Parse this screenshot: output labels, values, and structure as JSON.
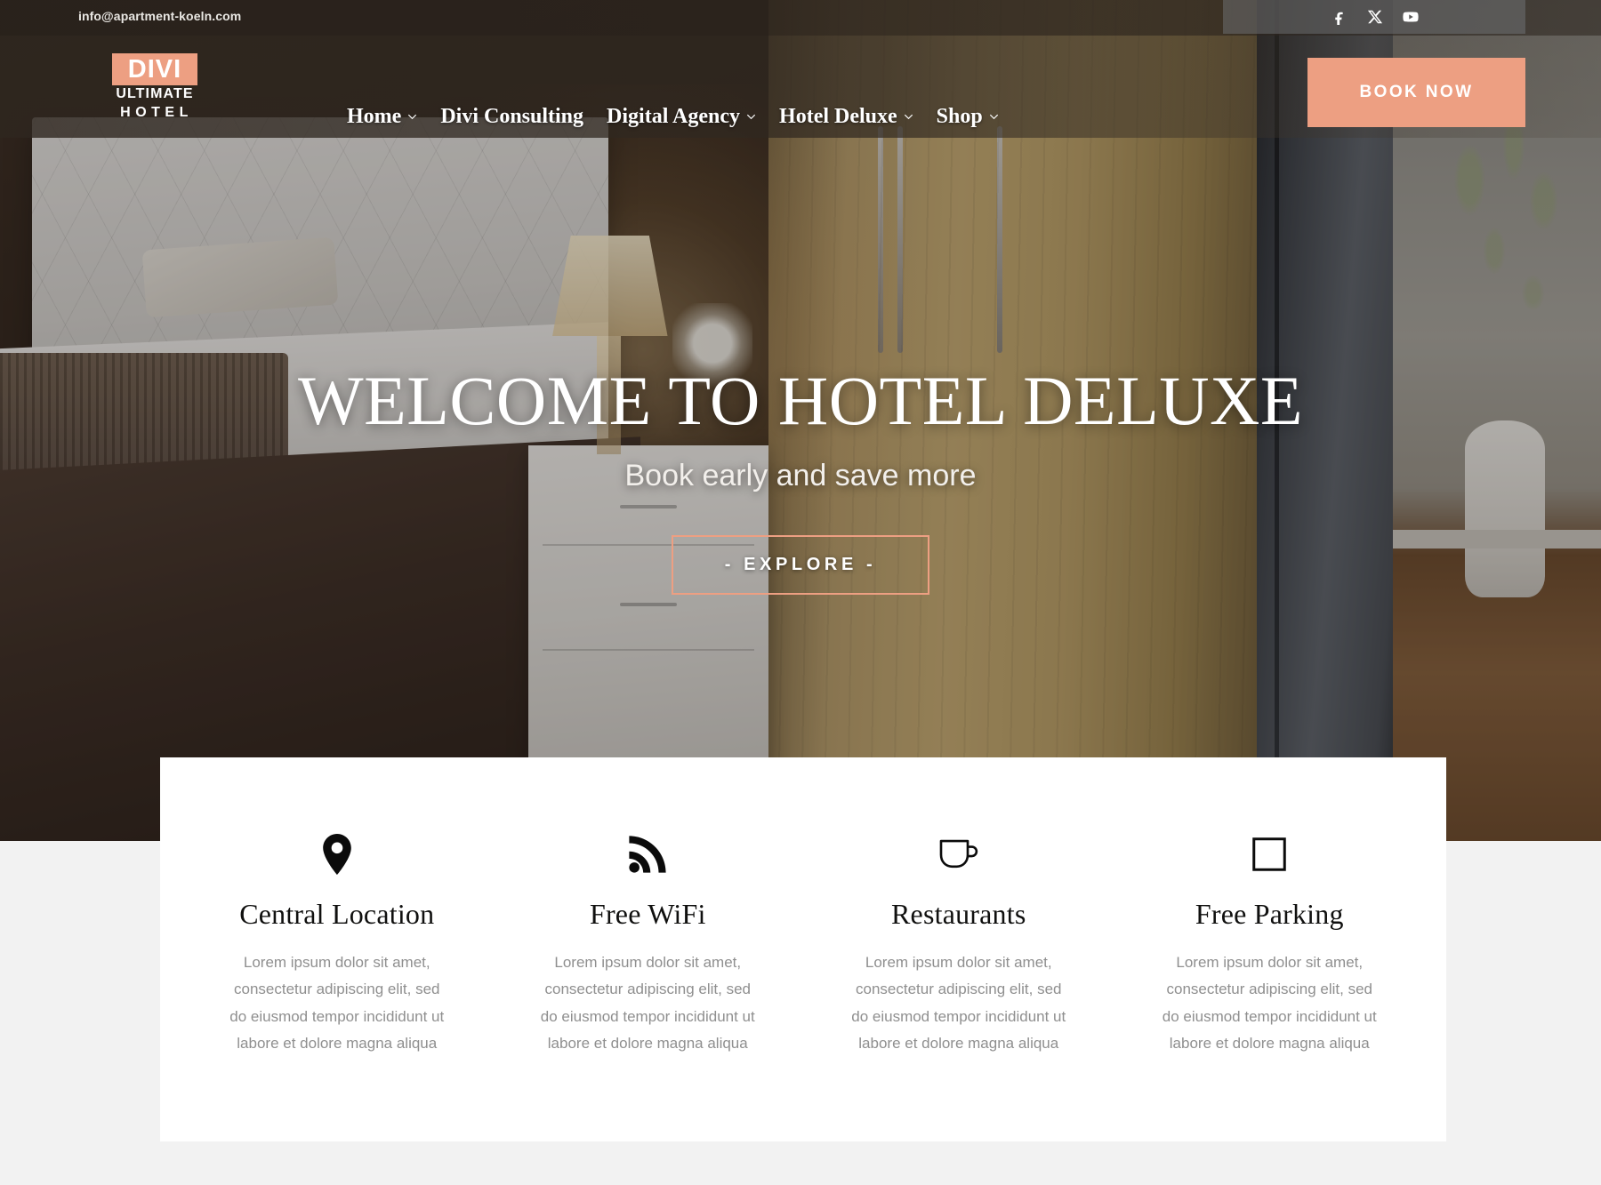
{
  "topbar": {
    "email": "info@apartment-koeln.com",
    "social": [
      {
        "name": "facebook-icon",
        "label": "Facebook"
      },
      {
        "name": "x-twitter-icon",
        "label": "X"
      },
      {
        "name": "youtube-icon",
        "label": "YouTube"
      }
    ]
  },
  "brand": {
    "line1": "DIVI",
    "line2": "ULTIMATE",
    "line3": "HOTEL",
    "accent_color": "#ed9f82"
  },
  "nav": {
    "items": [
      {
        "label": "Home",
        "has_dropdown": true
      },
      {
        "label": "Divi Consulting",
        "has_dropdown": false
      },
      {
        "label": "Digital Agency",
        "has_dropdown": true
      },
      {
        "label": "Hotel Deluxe",
        "has_dropdown": true
      },
      {
        "label": "Shop",
        "has_dropdown": true
      }
    ],
    "cta_label": "BOOK NOW"
  },
  "hero": {
    "title": "WELCOME TO HOTEL DELUXE",
    "subtitle": "Book early and save more",
    "button_label": "- EXPLORE -"
  },
  "features": [
    {
      "icon": "map-pin-icon",
      "title": "Central Location",
      "text": "Lorem ipsum dolor sit amet, consectetur adipiscing elit, sed do eiusmod tempor incididunt ut labore et dolore magna aliqua"
    },
    {
      "icon": "wifi-signal-icon",
      "title": "Free WiFi",
      "text": "Lorem ipsum dolor sit amet, consectetur adipiscing elit, sed do eiusmod tempor incididunt ut labore et dolore magna aliqua"
    },
    {
      "icon": "coffee-cup-icon",
      "title": "Restaurants",
      "text": "Lorem ipsum dolor sit amet, consectetur adipiscing elit, sed do eiusmod tempor incididunt ut labore et dolore magna aliqua"
    },
    {
      "icon": "square-outline-icon",
      "title": "Free Parking",
      "text": "Lorem ipsum dolor sit amet, consectetur adipiscing elit, sed do eiusmod tempor incididunt ut labore et dolore magna aliqua"
    }
  ],
  "colors": {
    "accent": "#ed9f82",
    "page_bg": "#f2f2f2",
    "card_bg": "#ffffff",
    "heading": "#10100f",
    "body_text": "#8f8f8f"
  }
}
